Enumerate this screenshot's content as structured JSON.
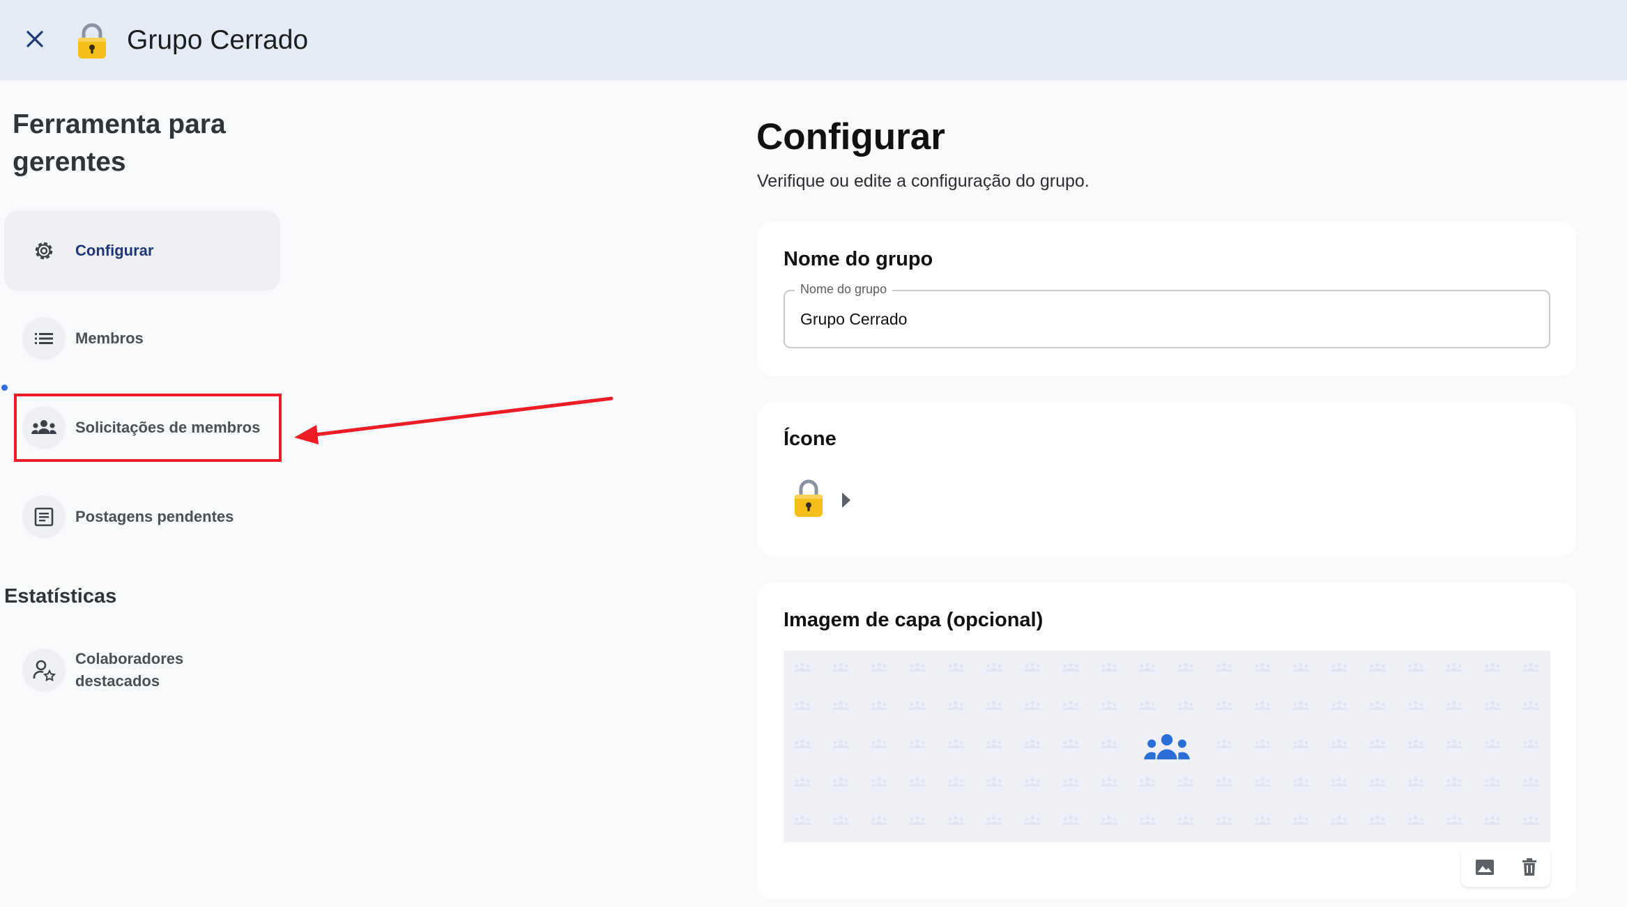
{
  "header": {
    "title": "Grupo Cerrado",
    "close_icon": "close-icon",
    "group_icon": "lock-emoji"
  },
  "sidebar": {
    "heading": "Ferramenta para gerentes",
    "items": [
      {
        "label": "Configurar",
        "icon": "gear-icon",
        "active": true
      },
      {
        "label": "Membros",
        "icon": "list-icon"
      },
      {
        "label": "Solicitações de membros",
        "icon": "group-icon",
        "highlighted": true
      },
      {
        "label": "Postagens pendentes",
        "icon": "document-icon"
      }
    ],
    "stats_heading": "Estatísticas",
    "stats_items": [
      {
        "label": "Colaboradores destacados",
        "icon": "person-star-icon"
      }
    ]
  },
  "main": {
    "title": "Configurar",
    "subtitle": "Verifique ou edite a configuração do grupo.",
    "name_card": {
      "title": "Nome do grupo",
      "field_label": "Nome do grupo",
      "field_value": "Grupo Cerrado"
    },
    "icon_card": {
      "title": "Ícone",
      "icon": "lock-emoji"
    },
    "cover_card": {
      "title": "Imagem de capa (opcional)",
      "actions": [
        "image-icon",
        "trash-icon"
      ]
    }
  },
  "colors": {
    "header_bg": "#e4ebf6",
    "active_label": "#1c3879",
    "annotation_red": "#ee1c25",
    "accent_blue": "#2f6fe6"
  }
}
